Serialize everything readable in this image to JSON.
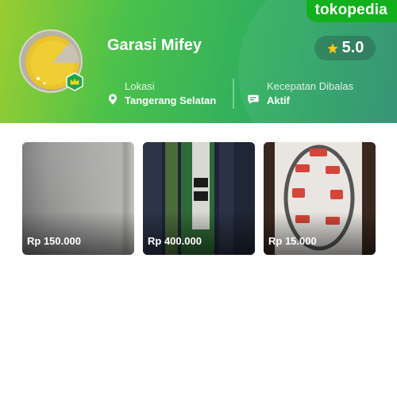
{
  "brand": {
    "logo_text": "tokopedia"
  },
  "shop": {
    "name": "Garasi Mifey",
    "rating": "5.0",
    "location_label": "Lokasi",
    "location_value": "Tangerang Selatan",
    "response_label": "Kecepatan Dibalas",
    "response_value": "Aktif"
  },
  "products": [
    {
      "price": "Rp 150.000"
    },
    {
      "price": "Rp 400.000"
    },
    {
      "price": "Rp 15.000"
    }
  ],
  "colors": {
    "brand_green": "#03ac0e",
    "star": "#ffc400",
    "badge": "#1ea64a"
  },
  "icons": {
    "rating": "star-icon",
    "location": "location-pin-icon",
    "response": "chat-bubble-icon",
    "badge": "crown-icon"
  }
}
